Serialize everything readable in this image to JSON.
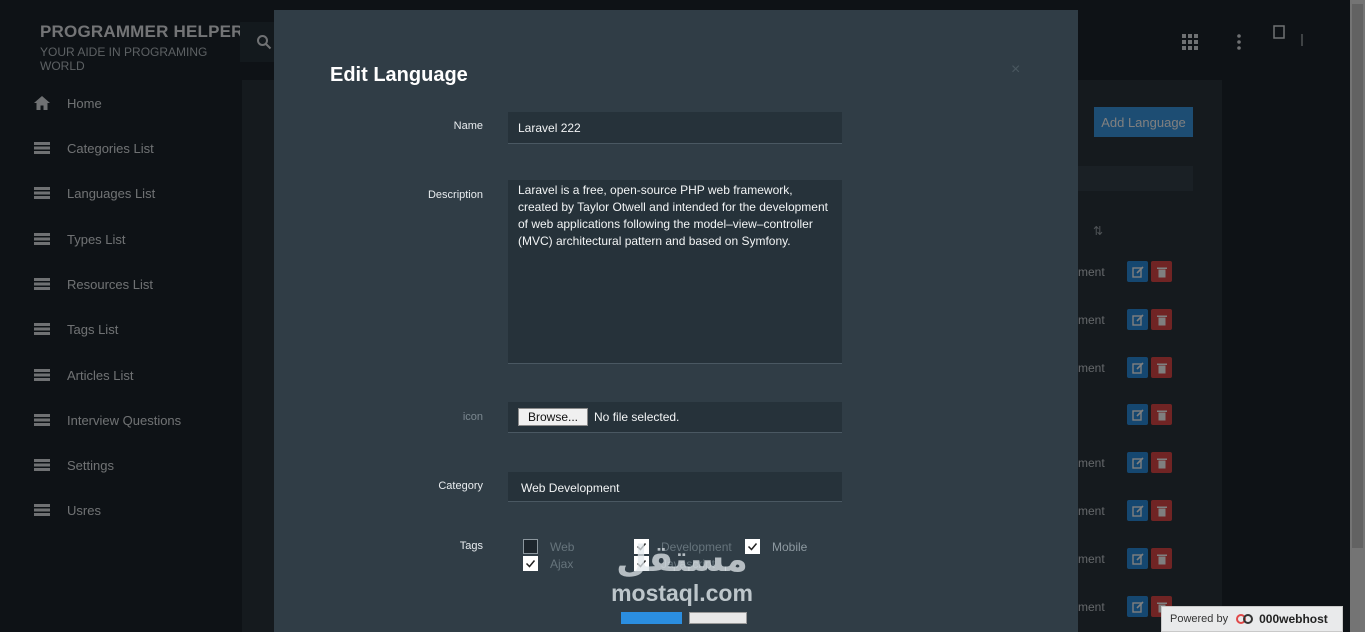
{
  "brand": {
    "name": "PROGRAMMER HELPER",
    "tagline": "YOUR AIDE IN PROGRAMING WORLD"
  },
  "sidebar": {
    "items": [
      {
        "label": "Home",
        "icon": "home-icon"
      },
      {
        "label": "Categories List",
        "icon": "list-icon"
      },
      {
        "label": "Languages List",
        "icon": "list-icon"
      },
      {
        "label": "Types List",
        "icon": "list-icon"
      },
      {
        "label": "Resources List",
        "icon": "list-icon"
      },
      {
        "label": "Tags List",
        "icon": "list-icon"
      },
      {
        "label": "Articles List",
        "icon": "list-icon"
      },
      {
        "label": "Interview Questions",
        "icon": "list-icon"
      },
      {
        "label": "Settings",
        "icon": "list-icon"
      },
      {
        "label": "Usres",
        "icon": "list-icon"
      }
    ]
  },
  "content": {
    "add_button": "Add Language",
    "row_fragment": "ment",
    "sort_glyph": "⇅"
  },
  "modal": {
    "title": "Edit Language",
    "close": "×",
    "name_label": "Name",
    "name_value": "Laravel 222",
    "description_label": "Description",
    "description_value": "Laravel is a free, open-source PHP web framework, created by Taylor Otwell and intended for the development of web applications following the model–view–controller (MVC) architectural pattern and based on Symfony.",
    "icon_label": "icon",
    "browse_label": "Browse...",
    "file_status": "No file selected.",
    "category_label": "Category",
    "category_value": "Web Development",
    "tags_label": "Tags",
    "tags": [
      {
        "label": "Web",
        "checked": false
      },
      {
        "label": "Development",
        "checked": true
      },
      {
        "label": "Mobile",
        "checked": true
      },
      {
        "label": "Ajax",
        "checked": true
      },
      {
        "label": "Javascript",
        "checked": true
      }
    ]
  },
  "watermark": {
    "arabic": "مستقل",
    "latin": "mostaql.com"
  },
  "powered": {
    "prefix": "Powered by",
    "host": "000webhost"
  },
  "colors": {
    "accent": "#2b8ee0",
    "danger": "#e04848",
    "modal_bg": "#303d46"
  }
}
